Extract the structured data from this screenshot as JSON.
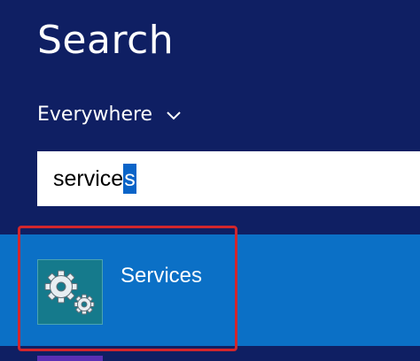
{
  "search": {
    "title": "Search",
    "scope_label": "Everywhere",
    "query_prefix": "service",
    "query_selected": "s"
  },
  "results": [
    {
      "label_match": "Service",
      "label_rest": "s",
      "icon": "gears-icon"
    }
  ],
  "colors": {
    "pane_background": "#0f1f63",
    "result_highlight": "#0b70c6",
    "annotation_frame": "#d2262c",
    "tile_background": "#157a8c"
  }
}
